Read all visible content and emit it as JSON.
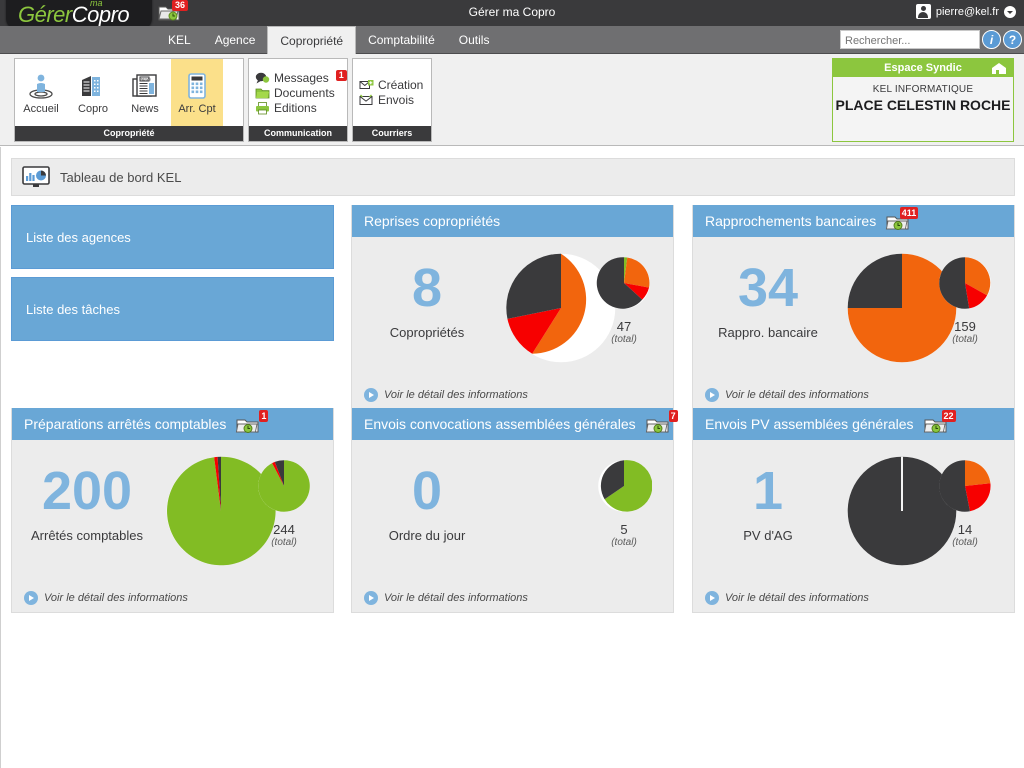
{
  "topbar": {
    "logo_prefix": "Gérer",
    "logo_sup": "ma",
    "logo_suffix": "Copro",
    "folder_badge": "36",
    "app_title": "Gérer ma Copro",
    "user_email": "pierre@kel.fr"
  },
  "menubar": {
    "items": [
      {
        "label": "KEL",
        "active": false
      },
      {
        "label": "Agence",
        "active": false
      },
      {
        "label": "Copropriété",
        "active": true
      },
      {
        "label": "Comptabilité",
        "active": false
      },
      {
        "label": "Outils",
        "active": false
      }
    ],
    "search_placeholder": "Rechercher...",
    "search_value": "",
    "info_label": "i",
    "help_label": "?"
  },
  "ribbon": {
    "groups": [
      {
        "title": "Copropriété",
        "buttons": [
          {
            "label": "Accueil",
            "icon": "home-person-icon",
            "selected": false
          },
          {
            "label": "Copro",
            "icon": "building-icon",
            "selected": false
          },
          {
            "label": "News",
            "icon": "newspaper-icon",
            "selected": false
          },
          {
            "label": "Arr. Cpt",
            "icon": "calculator-icon",
            "selected": true
          }
        ]
      },
      {
        "title": "Communication",
        "items": [
          {
            "label": "Messages",
            "icon": "chat-bubble-icon",
            "badge": "1"
          },
          {
            "label": "Documents",
            "icon": "folder-green-icon",
            "badge": ""
          },
          {
            "label": "Editions",
            "icon": "printer-green-icon",
            "badge": ""
          }
        ]
      },
      {
        "title": "Courriers",
        "items": [
          {
            "label": "Création",
            "icon": "envelope-add-icon",
            "badge": ""
          },
          {
            "label": "Envois",
            "icon": "envelope-send-icon",
            "badge": ""
          }
        ]
      }
    ]
  },
  "syndic": {
    "header": "Espace Syndic",
    "icon": "house-icon",
    "company": "KEL INFORMATIQUE",
    "name": "PLACE CELESTIN ROCHE"
  },
  "dashboard": {
    "header_icon": "dashboard-chart-icon",
    "header_title": "Tableau de bord KEL",
    "shortcuts": [
      {
        "label": "Liste des agences"
      },
      {
        "label": "Liste des tâches"
      }
    ],
    "detail_link": "Voir le détail des informations",
    "total_suffix": "(total)"
  },
  "colors": {
    "orange": "#f2650d",
    "dark": "#3a3a3c",
    "red": "#f70000",
    "green": "#82bc24",
    "blue": "#69a7d6",
    "blue_number": "#7fb4de"
  },
  "chart_data": [
    {
      "type": "pie",
      "title": "Reprises copropriétés",
      "badge": "",
      "value": "8",
      "value_label": "Copropriétés",
      "total": "47",
      "main": {
        "labels": [
          "orange",
          "dark",
          "red"
        ],
        "values": [
          62,
          25,
          13
        ],
        "colors": [
          "#f2650d",
          "#3a3a3c",
          "#f70000"
        ]
      },
      "small": {
        "labels": [
          "green",
          "orange",
          "red",
          "dark"
        ],
        "values": [
          2,
          26,
          8,
          64
        ],
        "colors": [
          "#82bc24",
          "#f2650d",
          "#f70000",
          "#3a3a3c"
        ]
      }
    },
    {
      "type": "pie",
      "title": "Rapprochements bancaires",
      "badge": "411",
      "value": "34",
      "value_label": "Rappro. bancaire",
      "total": "159",
      "main": {
        "labels": [
          "orange",
          "dark"
        ],
        "values": [
          75,
          25
        ],
        "colors": [
          "#f2650d",
          "#3a3a3c"
        ]
      },
      "small": {
        "labels": [
          "orange",
          "red",
          "dark"
        ],
        "values": [
          30,
          17,
          53
        ],
        "colors": [
          "#f2650d",
          "#f70000",
          "#3a3a3c"
        ]
      }
    },
    {
      "type": "pie",
      "title": "Préparations arrêtés comptables",
      "badge": "1",
      "value": "200",
      "value_label": "Arrêtés comptables",
      "total": "244",
      "main": {
        "labels": [
          "green",
          "red",
          "dark"
        ],
        "values": [
          94,
          3,
          3
        ],
        "colors": [
          "#82bc24",
          "#f70000",
          "#3a3a3c"
        ]
      },
      "small": {
        "labels": [
          "green",
          "red",
          "dark"
        ],
        "values": [
          88,
          3,
          9
        ],
        "colors": [
          "#82bc24",
          "#f70000",
          "#3a3a3c"
        ]
      }
    },
    {
      "type": "pie",
      "title": "Envois convocations assemblées générales",
      "badge": "7",
      "value": "0",
      "value_label": "Ordre du jour",
      "total": "5",
      "main": null,
      "small": {
        "labels": [
          "green",
          "dark"
        ],
        "values": [
          65,
          35
        ],
        "colors": [
          "#82bc24",
          "#3a3a3c"
        ]
      }
    },
    {
      "type": "pie",
      "title": "Envois PV assemblées générales",
      "badge": "22",
      "value": "1",
      "value_label": "PV d'AG",
      "total": "14",
      "main": {
        "labels": [
          "dark"
        ],
        "values": [
          100
        ],
        "colors": [
          "#3a3a3c"
        ]
      },
      "small": {
        "labels": [
          "orange",
          "red",
          "dark"
        ],
        "values": [
          22,
          30,
          48
        ],
        "colors": [
          "#f2650d",
          "#f70000",
          "#3a3a3c"
        ]
      }
    }
  ]
}
